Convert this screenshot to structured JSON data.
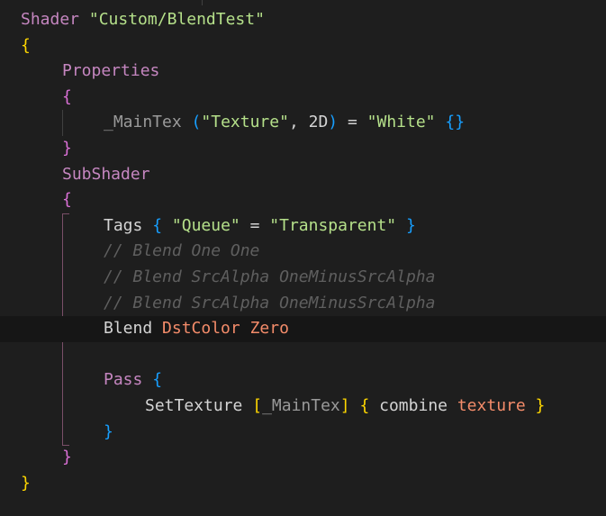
{
  "editor": {
    "colors": {
      "background": "#1e1e1e",
      "current_line": "#161616",
      "keyword": "#c586c0",
      "string": "#b5e08a",
      "brace_level_1": "#ffd700",
      "brace_level_2": "#da70d6",
      "brace_level_3": "#179fff",
      "comment": "#5f5f5f",
      "enum_value": "#f48c6a"
    },
    "lines": [
      {
        "indent": 0,
        "tokens": [
          {
            "text": "Shader",
            "kind": "keyword"
          },
          {
            "text": " ",
            "kind": "punct"
          },
          {
            "text": "\"Custom/BlendTest\"",
            "kind": "string"
          }
        ]
      },
      {
        "indent": 0,
        "tokens": [
          {
            "text": "{",
            "kind": "brace1"
          }
        ]
      },
      {
        "indent": 1,
        "tokens": [
          {
            "text": "Properties",
            "kind": "keyword"
          }
        ]
      },
      {
        "indent": 1,
        "tokens": [
          {
            "text": "{",
            "kind": "brace2"
          }
        ]
      },
      {
        "indent": 2,
        "tokens": [
          {
            "text": "_MainTex",
            "kind": "dim"
          },
          {
            "text": " ",
            "kind": "punct"
          },
          {
            "text": "(",
            "kind": "brace3"
          },
          {
            "text": "\"Texture\"",
            "kind": "string"
          },
          {
            "text": ", 2D",
            "kind": "punct"
          },
          {
            "text": ")",
            "kind": "brace3"
          },
          {
            "text": " = ",
            "kind": "punct"
          },
          {
            "text": "\"White\"",
            "kind": "string"
          },
          {
            "text": " ",
            "kind": "punct"
          },
          {
            "text": "{}",
            "kind": "brace3"
          }
        ]
      },
      {
        "indent": 1,
        "tokens": [
          {
            "text": "}",
            "kind": "brace2"
          }
        ]
      },
      {
        "indent": 1,
        "tokens": [
          {
            "text": "SubShader",
            "kind": "keyword"
          }
        ]
      },
      {
        "indent": 1,
        "tokens": [
          {
            "text": "{",
            "kind": "brace2"
          }
        ]
      },
      {
        "indent": 2,
        "tokens": [
          {
            "text": "Tags",
            "kind": "ident"
          },
          {
            "text": " ",
            "kind": "punct"
          },
          {
            "text": "{",
            "kind": "brace3"
          },
          {
            "text": " ",
            "kind": "punct"
          },
          {
            "text": "\"Queue\"",
            "kind": "string"
          },
          {
            "text": " = ",
            "kind": "punct"
          },
          {
            "text": "\"Transparent\"",
            "kind": "string"
          },
          {
            "text": " ",
            "kind": "punct"
          },
          {
            "text": "}",
            "kind": "brace3"
          }
        ]
      },
      {
        "indent": 2,
        "tokens": [
          {
            "text": "// Blend One One",
            "kind": "comment"
          }
        ]
      },
      {
        "indent": 2,
        "tokens": [
          {
            "text": "// Blend SrcAlpha OneMinusSrcAlpha",
            "kind": "comment"
          }
        ]
      },
      {
        "indent": 2,
        "tokens": [
          {
            "text": "// Blend SrcAlpha OneMinusSrcAlpha",
            "kind": "comment"
          }
        ]
      },
      {
        "indent": 2,
        "current": true,
        "tokens": [
          {
            "text": "Blend",
            "kind": "ident"
          },
          {
            "text": " ",
            "kind": "punct"
          },
          {
            "text": "DstColor",
            "kind": "enum"
          },
          {
            "text": " ",
            "kind": "punct"
          },
          {
            "text": "Zero",
            "kind": "enum"
          }
        ]
      },
      {
        "indent": 0,
        "tokens": []
      },
      {
        "indent": 2,
        "tokens": [
          {
            "text": "Pass",
            "kind": "keyword"
          },
          {
            "text": " ",
            "kind": "punct"
          },
          {
            "text": "{",
            "kind": "brace3"
          }
        ]
      },
      {
        "indent": 3,
        "tokens": [
          {
            "text": "SetTexture",
            "kind": "ident"
          },
          {
            "text": " ",
            "kind": "punct"
          },
          {
            "text": "[",
            "kind": "brace1"
          },
          {
            "text": "_MainTex",
            "kind": "dim"
          },
          {
            "text": "]",
            "kind": "brace1"
          },
          {
            "text": " ",
            "kind": "punct"
          },
          {
            "text": "{",
            "kind": "brace1"
          },
          {
            "text": " combine ",
            "kind": "ident"
          },
          {
            "text": "texture",
            "kind": "enum"
          },
          {
            "text": " ",
            "kind": "punct"
          },
          {
            "text": "}",
            "kind": "brace1"
          }
        ]
      },
      {
        "indent": 2,
        "tokens": [
          {
            "text": "}",
            "kind": "brace3"
          }
        ]
      },
      {
        "indent": 1,
        "tokens": [
          {
            "text": "}",
            "kind": "brace2"
          }
        ]
      },
      {
        "indent": 0,
        "tokens": [
          {
            "text": "}",
            "kind": "brace1"
          }
        ]
      }
    ]
  }
}
